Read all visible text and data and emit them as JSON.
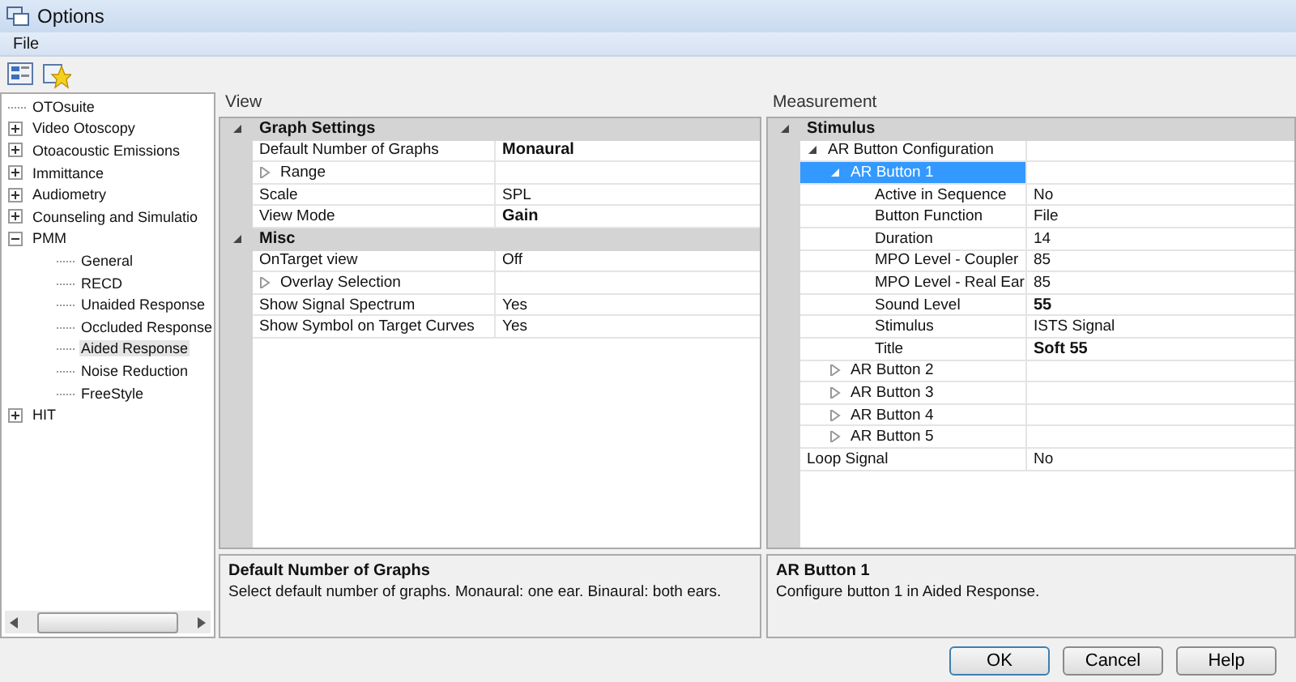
{
  "window": {
    "title": "Options"
  },
  "menu": [
    "File"
  ],
  "tree": [
    {
      "label": "OTOsuite",
      "selected": false
    },
    {
      "label": "Video Otoscopy",
      "expanded": false,
      "selected": false
    },
    {
      "label": "Otoacoustic Emissions",
      "expanded": false,
      "selected": false
    },
    {
      "label": "Immittance",
      "expanded": false,
      "selected": false
    },
    {
      "label": "Audiometry",
      "expanded": false,
      "selected": false
    },
    {
      "label": "Counseling and Simulatio",
      "expanded": false,
      "selected": false
    },
    {
      "label": "PMM",
      "expanded": true,
      "selected": false,
      "children": [
        {
          "label": "General",
          "selected": false
        },
        {
          "label": "RECD",
          "selected": false
        },
        {
          "label": "Unaided Response",
          "selected": false
        },
        {
          "label": "Occluded Response",
          "selected": false
        },
        {
          "label": "Aided Response",
          "selected": true
        },
        {
          "label": "Noise Reduction",
          "selected": false
        },
        {
          "label": "FreeStyle",
          "selected": false
        }
      ]
    },
    {
      "label": "HIT",
      "expanded": false,
      "selected": false
    }
  ],
  "panels": [
    {
      "header": "View",
      "categories": [
        {
          "name": "Graph Settings",
          "expanded": true,
          "rows": [
            {
              "name": "Default Number of Graphs",
              "value": "Monaural",
              "bold": true,
              "selected": false
            },
            {
              "name": "Range",
              "expanded": false,
              "selected": false
            },
            {
              "name": "Scale",
              "value": "SPL",
              "bold": false,
              "selected": false
            },
            {
              "name": "View Mode",
              "value": "Gain",
              "bold": true,
              "selected": false
            }
          ]
        },
        {
          "name": "Misc",
          "expanded": true,
          "rows": [
            {
              "name": "OnTarget view",
              "value": "Off",
              "bold": false,
              "selected": false
            },
            {
              "name": "Overlay Selection",
              "expanded": false,
              "selected": false
            },
            {
              "name": "Show Signal Spectrum",
              "value": "Yes",
              "bold": false,
              "selected": false
            },
            {
              "name": "Show Symbol on Target Curves",
              "value": "Yes",
              "bold": false,
              "selected": false
            }
          ]
        }
      ],
      "description": {
        "title": "Default Number of Graphs",
        "text": "Select default number of graphs. Monaural: one ear. Binaural: both ears."
      }
    },
    {
      "header": "Measurement",
      "categories": [
        {
          "name": "Stimulus",
          "expanded": true,
          "rows": [
            {
              "name": "AR Button Configuration",
              "expanded": true,
              "selected": false,
              "children": [
                {
                  "name": "AR Button 1",
                  "expanded": true,
                  "selected": true,
                  "children": [
                    {
                      "name": "Active in Sequence",
                      "value": "No",
                      "bold": false,
                      "selected": false
                    },
                    {
                      "name": "Button Function",
                      "value": "File",
                      "bold": false,
                      "selected": false
                    },
                    {
                      "name": "Duration",
                      "value": "14",
                      "bold": false,
                      "selected": false
                    },
                    {
                      "name": "MPO Level - Coupler",
                      "value": "85",
                      "bold": false,
                      "selected": false
                    },
                    {
                      "name": "MPO Level - Real Ear",
                      "value": "85",
                      "bold": false,
                      "selected": false
                    },
                    {
                      "name": "Sound Level",
                      "value": "55",
                      "bold": true,
                      "selected": false
                    },
                    {
                      "name": "Stimulus",
                      "value": "ISTS Signal",
                      "bold": false,
                      "selected": false
                    },
                    {
                      "name": "Title",
                      "value": "Soft 55",
                      "bold": true,
                      "selected": false
                    }
                  ]
                },
                {
                  "name": "AR Button 2",
                  "expanded": false,
                  "selected": false
                },
                {
                  "name": "AR Button 3",
                  "expanded": false,
                  "selected": false
                },
                {
                  "name": "AR Button 4",
                  "expanded": false,
                  "selected": false
                },
                {
                  "name": "AR Button 5",
                  "expanded": false,
                  "selected": false
                }
              ]
            },
            {
              "name": "Loop Signal",
              "value": "No",
              "bold": false,
              "selected": false
            }
          ]
        }
      ],
      "description": {
        "title": "AR Button 1",
        "text": "Configure button 1 in Aided Response."
      }
    }
  ],
  "buttons": [
    "OK",
    "Cancel",
    "Help"
  ]
}
